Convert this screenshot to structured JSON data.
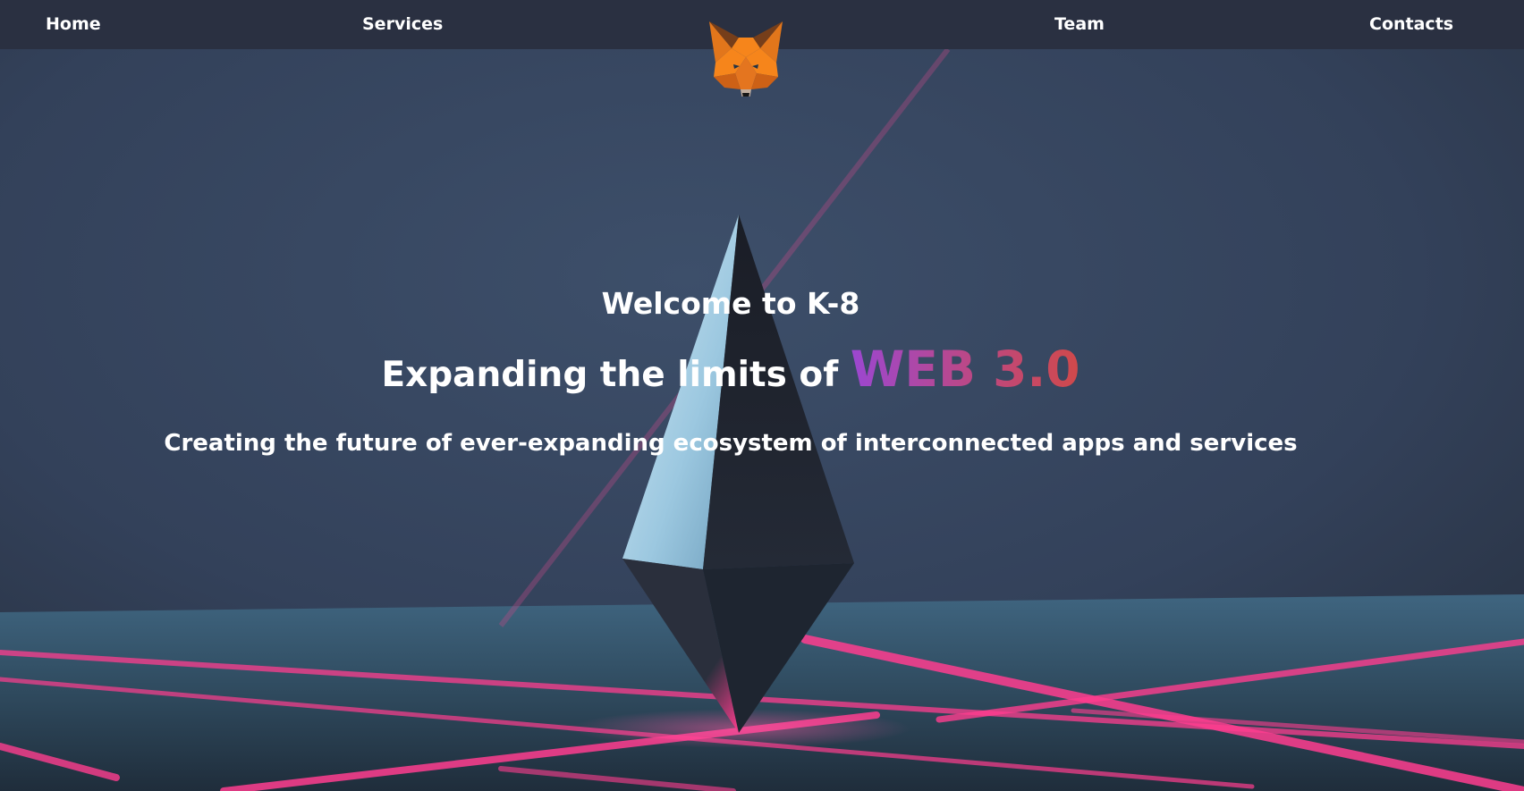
{
  "nav": {
    "home": "Home",
    "services": "Services",
    "team": "Team",
    "contacts": "Contacts",
    "logo_icon": "metamask-fox-icon"
  },
  "hero": {
    "welcome": "Welcome to K-8",
    "headline_prefix": "Expanding the limits of",
    "headline_accent": "WEB 3.0",
    "tagline": "Creating the future of ever-expanding ecosystem of interconnected apps and services"
  },
  "colors": {
    "navbar": "#2a3041",
    "accent_start": "#9b47d1",
    "accent_end": "#d0494a",
    "laser_pink": "#ff3d8f",
    "text": "#ffffff"
  }
}
